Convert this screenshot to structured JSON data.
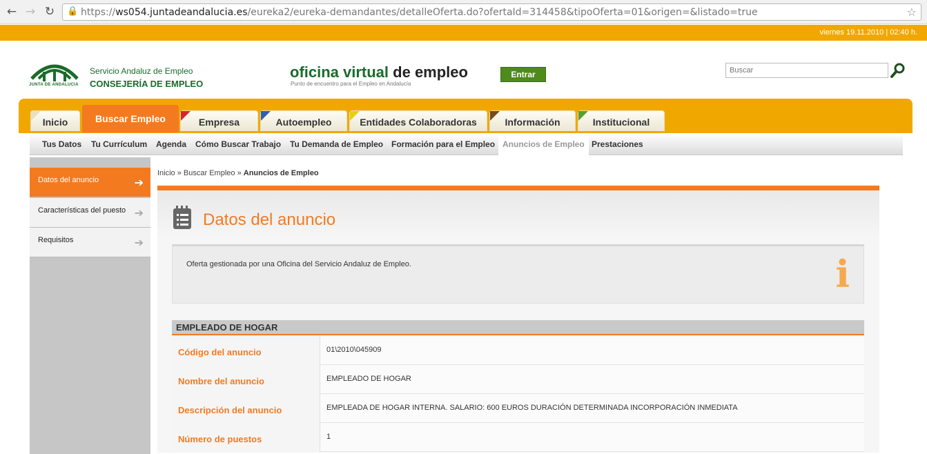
{
  "browser": {
    "back_icon": "back-arrow-icon",
    "forward_icon": "forward-arrow-icon",
    "reload_icon": "reload-icon",
    "url_scheme": "https://",
    "url_host": "ws054.juntadeandalucia.es",
    "url_path": "/eureka2/eureka-demandantes/detalleOferta.do?ofertaId=314458&tipoOferta=01&origen=&listado=true"
  },
  "header": {
    "date": "viernes 19.11.2010 | 02:40 h.",
    "logo_caption": "JUNTA DE ANDALUCIA",
    "org_line1": "Servicio Andaluz de Empleo",
    "org_line2": "CONSEJERÍA DE EMPLEO",
    "ov_green": "oficina virtual",
    "ov_black": " de empleo",
    "ov_sub": "Punto de encuentro para el Empleo en Andalucía",
    "entrar": "Entrar",
    "search_placeholder": "Buscar"
  },
  "colors": {
    "accent": "#f47a20",
    "header_bar": "#f0a800",
    "brand_green": "#1a6b2a"
  },
  "main_nav": [
    {
      "label": "Inicio"
    },
    {
      "label": "Buscar Empleo"
    },
    {
      "label": "Empresa"
    },
    {
      "label": "Autoempleo"
    },
    {
      "label": "Entidades Colaboradoras"
    },
    {
      "label": "Información"
    },
    {
      "label": "Institucional"
    }
  ],
  "sub_nav": [
    {
      "label": "Tus Datos"
    },
    {
      "label": "Tu Currículum"
    },
    {
      "label": "Agenda"
    },
    {
      "label": "Cómo Buscar Trabajo"
    },
    {
      "label": "Tu Demanda de Empleo"
    },
    {
      "label": "Formación para el Empleo"
    },
    {
      "label": "Anuncios de Empleo"
    },
    {
      "label": "Prestaciones"
    }
  ],
  "sidebar": [
    {
      "label": "Datos del anuncio"
    },
    {
      "label": "Características del puesto"
    },
    {
      "label": "Requisitos"
    }
  ],
  "breadcrumb": {
    "home": "Inicio",
    "section": "Buscar Empleo",
    "current": "Anuncios de Empleo"
  },
  "content": {
    "title": "Datos del anuncio",
    "info_text": "Oferta gestionada por una Oficina del Servicio Andaluz de Empleo.",
    "info_glyph": "i",
    "table_title": "EMPLEADO DE HOGAR",
    "rows": [
      {
        "key": "Código del anuncio",
        "value": "01\\2010\\045909"
      },
      {
        "key": "Nombre del anuncio",
        "value": "EMPLEADO DE HOGAR"
      },
      {
        "key": "Descripción del anuncio",
        "value": "EMPLEADA DE HOGAR INTERNA. SALARIO: 600 EUROS DURACIÓN DETERMINADA INCORPORACIÓN INMEDIATA"
      },
      {
        "key": "Número de puestos",
        "value": "1"
      }
    ]
  }
}
